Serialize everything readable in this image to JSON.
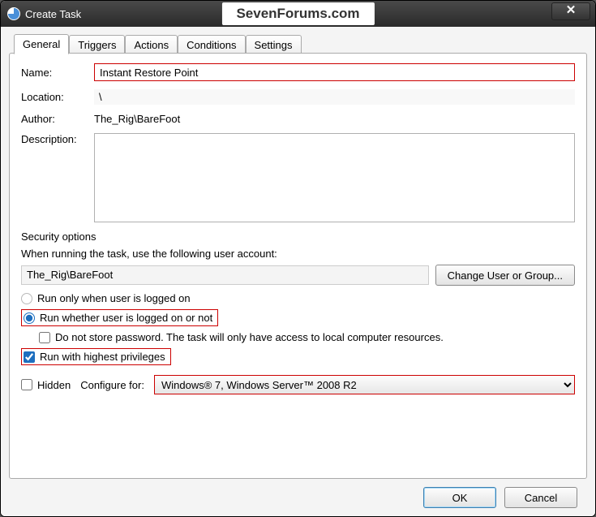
{
  "window": {
    "title": "Create Task",
    "watermark": "SevenForums.com",
    "close_glyph": "✕"
  },
  "tabs": [
    "General",
    "Triggers",
    "Actions",
    "Conditions",
    "Settings"
  ],
  "general": {
    "name_label": "Name:",
    "name_value": "Instant Restore Point",
    "location_label": "Location:",
    "location_value": "\\",
    "author_label": "Author:",
    "author_value": "The_Rig\\BareFoot",
    "description_label": "Description:",
    "description_value": ""
  },
  "security": {
    "section_title": "Security options",
    "run_as_text": "When running the task, use the following user account:",
    "account": "The_Rig\\BareFoot",
    "change_user_label": "Change User or Group...",
    "radio_logged_on": "Run only when user is logged on",
    "radio_logged_or_not": "Run whether user is logged on or not",
    "do_not_store_pw": "Do not store password.  The task will only have access to local computer resources.",
    "highest_priv": "Run with highest privileges"
  },
  "bottom": {
    "hidden_label": "Hidden",
    "configure_for_label": "Configure for:",
    "configure_for_value": "Windows® 7, Windows Server™ 2008 R2"
  },
  "footer": {
    "ok": "OK",
    "cancel": "Cancel"
  }
}
